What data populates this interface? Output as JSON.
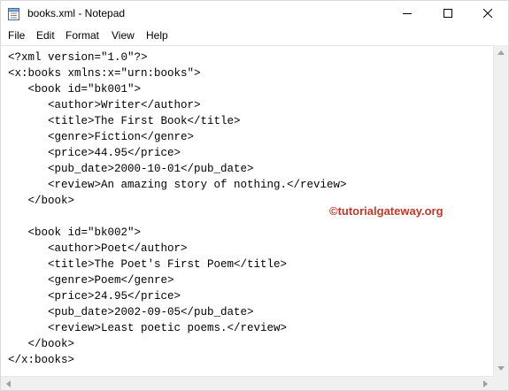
{
  "window": {
    "title": "books.xml - Notepad"
  },
  "menu": {
    "file": "File",
    "edit": "Edit",
    "format": "Format",
    "view": "View",
    "help": "Help"
  },
  "editor": {
    "content": "<?xml version=\"1.0\"?>\n<x:books xmlns:x=\"urn:books\">\n   <book id=\"bk001\">\n      <author>Writer</author>\n      <title>The First Book</title>\n      <genre>Fiction</genre>\n      <price>44.95</price>\n      <pub_date>2000-10-01</pub_date>\n      <review>An amazing story of nothing.</review>\n   </book>\n\n   <book id=\"bk002\">\n      <author>Poet</author>\n      <title>The Poet's First Poem</title>\n      <genre>Poem</genre>\n      <price>24.95</price>\n      <pub_date>2002-09-05</pub_date>\n      <review>Least poetic poems.</review>\n   </book>\n</x:books>"
  },
  "watermark": {
    "text": "©tutorialgateway.org",
    "color": "#c0392b"
  },
  "icons": {
    "app": "notepad-icon",
    "minimize": "minimize-icon",
    "maximize": "maximize-icon",
    "close": "close-icon"
  }
}
